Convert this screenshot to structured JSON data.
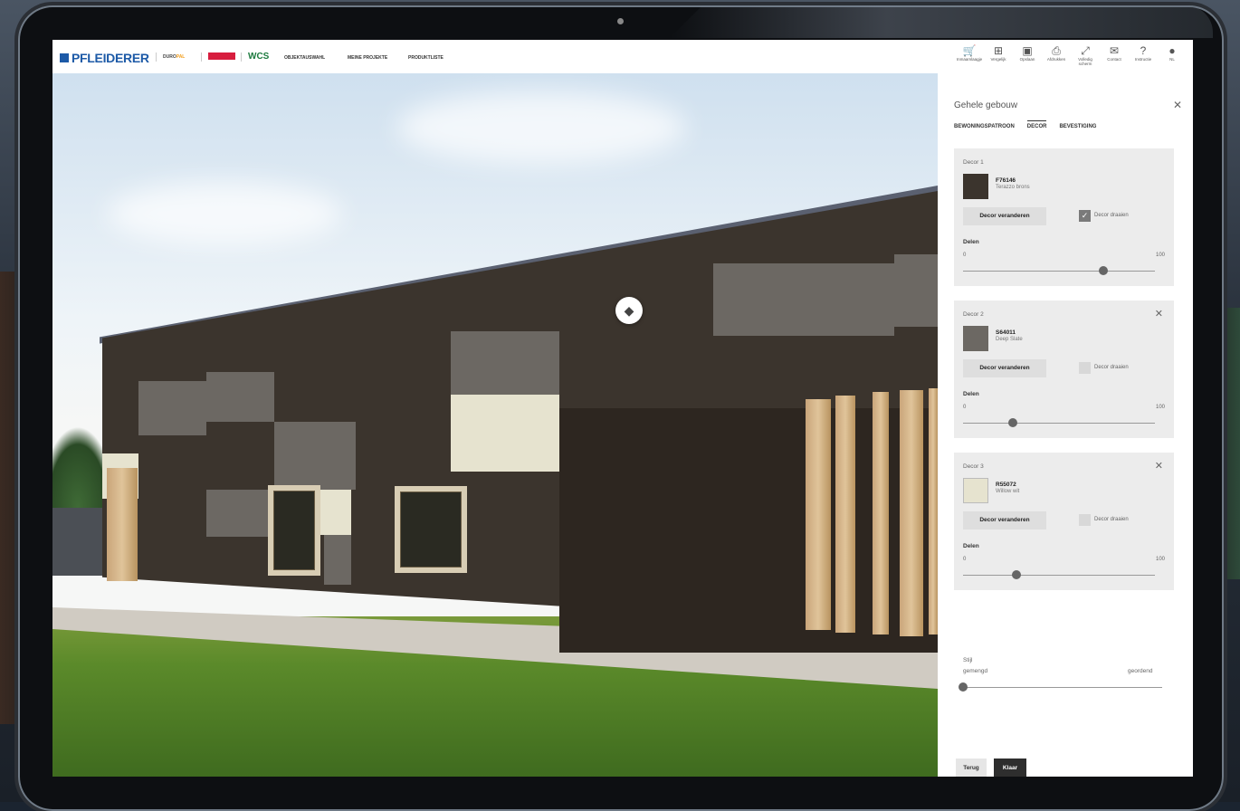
{
  "brand": {
    "logo_text": "PFLEIDERER",
    "duropal_prefix": "DURO",
    "duropal_suffix": "PAL",
    "wcs": "WCS"
  },
  "nav": [
    "OBJEKTAUSWAHL",
    "MEINE PROJEKTE",
    "PRODUKTLISTE"
  ],
  "toolbar": [
    {
      "icon": "cart-icon",
      "glyph": "🛒",
      "label": "Inmaamlaagje"
    },
    {
      "icon": "compare-icon",
      "glyph": "⊞",
      "label": "Vergelijk"
    },
    {
      "icon": "save-icon",
      "glyph": "▣",
      "label": "Opslaan"
    },
    {
      "icon": "print-icon",
      "glyph": "⎙",
      "label": "Afdrukken"
    },
    {
      "icon": "fullscreen-icon",
      "glyph": "⤢",
      "label": "Volledig scherm"
    },
    {
      "icon": "contact-icon",
      "glyph": "✉",
      "label": "Contact"
    },
    {
      "icon": "help-icon",
      "glyph": "?",
      "label": "Instructie"
    },
    {
      "icon": "language-icon",
      "glyph": "●",
      "label": "NL"
    }
  ],
  "panel": {
    "title": "Gehele gebouw",
    "tabs": [
      "BEWONINGSPATROON",
      "DECOR",
      "BEVESTIGING"
    ],
    "active_tab": "DECOR",
    "decors": [
      {
        "title": "Decor 1",
        "code": "F76146",
        "name": "Terazzo brons",
        "color": "#3b342d",
        "change_label": "Decor veranderen",
        "rotate_label": "Decor draaien",
        "rotate_checked": true,
        "share_label": "Delen",
        "min": "0",
        "max": "100",
        "value": 0.73,
        "removable": false
      },
      {
        "title": "Decor 2",
        "code": "S64011",
        "name": "Deep Slate",
        "color": "#6c6863",
        "change_label": "Decor veranderen",
        "rotate_label": "Decor draaien",
        "rotate_checked": false,
        "share_label": "Delen",
        "min": "0",
        "max": "100",
        "value": 0.26,
        "removable": true
      },
      {
        "title": "Decor 3",
        "code": "R55072",
        "name": "Willow wit",
        "color": "#e6e3cf",
        "change_label": "Decor veranderen",
        "rotate_label": "Decor draaien",
        "rotate_checked": false,
        "share_label": "Delen",
        "min": "0",
        "max": "100",
        "value": 0.28,
        "removable": true
      }
    ],
    "style_label": "Stijl",
    "style_min": "gemengd",
    "style_max": "geordend",
    "style_value": 0.0,
    "back_label": "Terug",
    "done_label": "Klaar"
  }
}
